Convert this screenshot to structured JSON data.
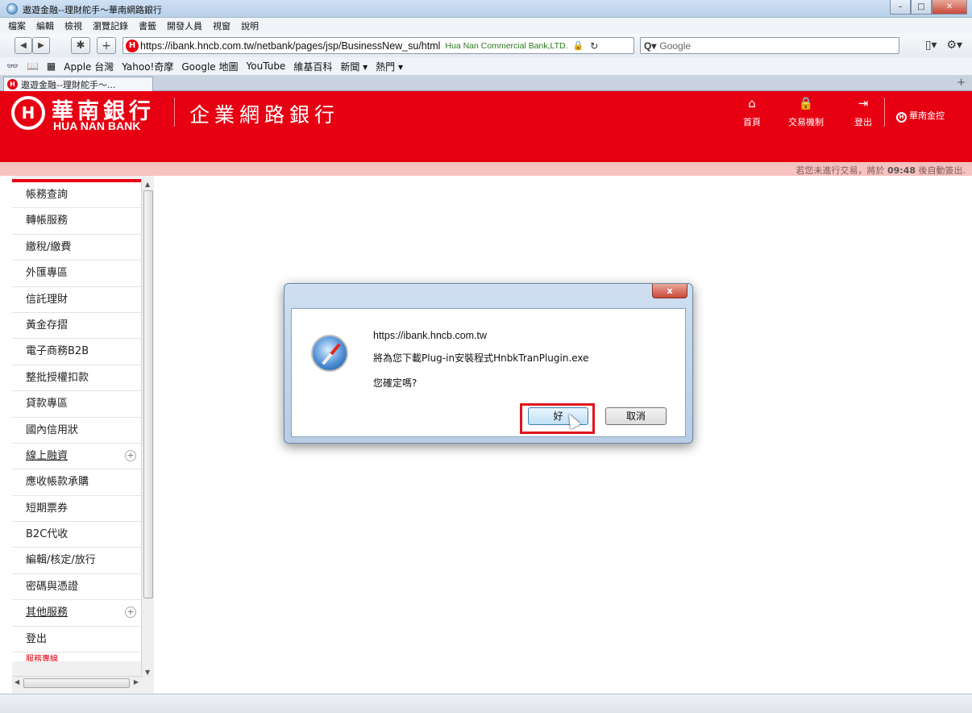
{
  "window": {
    "title": "遨遊金融--理財舵手～華南網路銀行",
    "minimize": "–",
    "maximize": "□",
    "close": "✕"
  },
  "menu": [
    "檔案",
    "編輯",
    "檢視",
    "瀏覽記錄",
    "書籤",
    "開發人員",
    "視窗",
    "說明"
  ],
  "address_bar": {
    "back": "◀",
    "forward": "▶",
    "url": "https://ibank.hncb.com.tw/netbank/pages/jsp/BusinessNew_su/html",
    "cert_owner": "Hua Nan Commercial Bank,LTD.",
    "lock": "🔒",
    "reload": "↻",
    "search_placeholder": "Google",
    "search_glyph": "Q▾"
  },
  "bookmarks": [
    "Apple 台灣",
    "Yahoo!奇摩",
    "Google 地圖",
    "YouTube",
    "維基百科",
    "新聞 ▾",
    "熱門 ▾"
  ],
  "tab": {
    "title": "遨遊金融--理財舵手～...",
    "new_tab": "+"
  },
  "bank": {
    "name_cn": "華南銀行",
    "name_en": "HUA NAN BANK",
    "portal_title": "企業網路銀行",
    "logo_glyph": "H",
    "nav": [
      {
        "label": "首頁",
        "icon": "home-icon",
        "glyph": "⌂"
      },
      {
        "label": "交易機制",
        "icon": "lock-icon",
        "glyph": "🔒"
      },
      {
        "label": "登出",
        "icon": "logout-icon",
        "glyph": "⇥"
      }
    ],
    "holding_link": "華南金控",
    "timeout_prefix": "若您未進行交易，將於",
    "timeout_time": "09:48",
    "timeout_suffix": "後自動簽出."
  },
  "sidebar": {
    "items": [
      {
        "label": "帳務查詢"
      },
      {
        "label": "轉帳服務"
      },
      {
        "label": "繳稅/繳費"
      },
      {
        "label": "外匯專區"
      },
      {
        "label": "信託理財"
      },
      {
        "label": "黃金存摺"
      },
      {
        "label": "電子商務B2B"
      },
      {
        "label": "整批授權扣款"
      },
      {
        "label": "貸款專區"
      },
      {
        "label": "國內信用狀"
      },
      {
        "label": "線上融資",
        "expand": "+"
      },
      {
        "label": "應收帳款承購"
      },
      {
        "label": "短期票券"
      },
      {
        "label": "B2C代收"
      },
      {
        "label": "編輯/核定/放行"
      },
      {
        "label": "密碼與憑證"
      },
      {
        "label": "其他服務",
        "expand": "+"
      },
      {
        "label": "登出"
      }
    ],
    "cut_item": "服務專線"
  },
  "dialog": {
    "close": "x",
    "origin": "https://ibank.hncb.com.tw",
    "message": "將為您下載Plug-in安裝程式HnbkTranPlugin.exe",
    "question": "您確定嗎?",
    "ok_label": "好",
    "cancel_label": "取消"
  },
  "colors": {
    "brand_red": "#e60012",
    "timeout_bar": "#f7c2c0",
    "highlight": "#e0141c"
  }
}
